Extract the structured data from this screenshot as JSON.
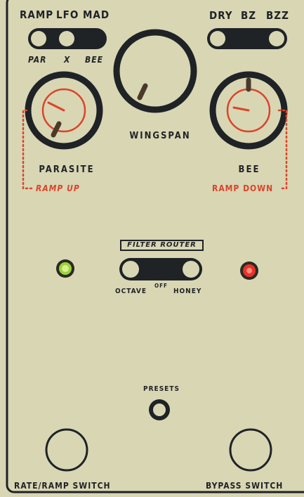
{
  "top_left_switch": {
    "top_labels": [
      "RAMP",
      "LFO",
      "MAD"
    ],
    "bottom_labels": [
      "PAR",
      "X",
      "BEE"
    ],
    "selected": "MAD"
  },
  "top_right_switch": {
    "top_labels": [
      "DRY",
      "BZ",
      "BZZ"
    ],
    "selected": "BZ"
  },
  "knobs": {
    "wingspan": "WINGSPAN",
    "parasite": "PARASITE",
    "bee": "BEE",
    "ramp_up": "RAMP UP",
    "ramp_down": "RAMP DOWN"
  },
  "filter_router": {
    "title": "FILTER ROUTER",
    "left": "OCTAVE",
    "middle": "OFF",
    "right": "HONEY",
    "selected": "OFF"
  },
  "leds": {
    "left_color": "#9bd23a",
    "right_color": "#e8322a"
  },
  "presets": "PRESETS",
  "footswitches": {
    "left": "RATE/RAMP SWITCH",
    "right": "BYPASS SWITCH"
  },
  "colors": {
    "panel": "#d9d6b4",
    "ink": "#1f2326",
    "accent": "#d9452b"
  }
}
